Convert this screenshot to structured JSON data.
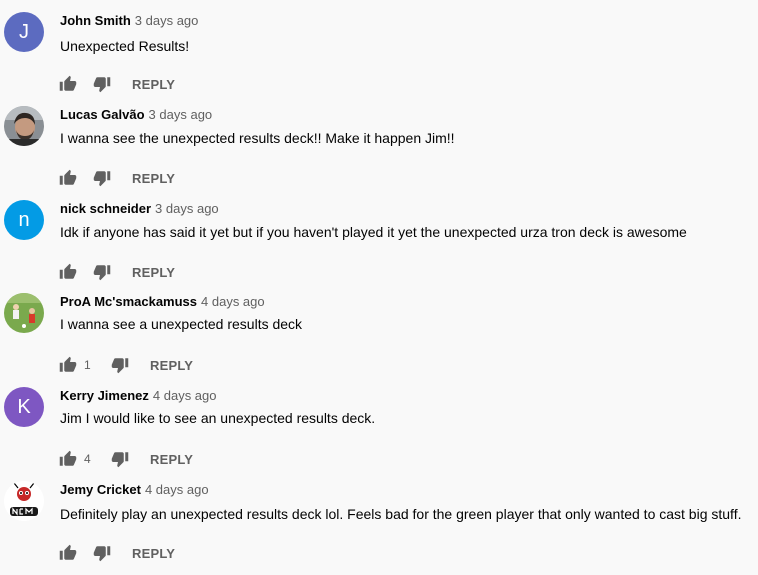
{
  "comments": [
    {
      "author": "John Smith",
      "time": "3 days ago",
      "text": "Unexpected Results!",
      "likes": "",
      "reply_label": "REPLY",
      "avatar": {
        "type": "letter",
        "letter": "J",
        "color": "#5c6bc0"
      }
    },
    {
      "author": "Lucas Galvão",
      "time": "3 days ago",
      "text": "I wanna see the unexpected results deck!! Make it happen Jim!!",
      "likes": "",
      "reply_label": "REPLY",
      "avatar": {
        "type": "photo-person"
      }
    },
    {
      "author": "nick schneider",
      "time": "3 days ago",
      "text": "Idk if anyone has said it yet but if you haven't played it yet the unexpected urza tron deck is awesome",
      "likes": "",
      "reply_label": "REPLY",
      "avatar": {
        "type": "letter",
        "letter": "n",
        "color": "#039be5"
      }
    },
    {
      "author": "ProA Mc'smackamuss",
      "time": "4 days ago",
      "text": "I wanna see a unexpected results deck",
      "likes": "1",
      "reply_label": "REPLY",
      "avatar": {
        "type": "photo-field"
      }
    },
    {
      "author": "Kerry Jimenez",
      "time": "4 days ago",
      "text": "Jim I would like to see an unexpected results deck.",
      "likes": "4",
      "reply_label": "REPLY",
      "avatar": {
        "type": "letter",
        "letter": "K",
        "color": "#7e57c2"
      }
    },
    {
      "author": "Jemy Cricket",
      "time": "4 days ago",
      "text": "Definitely play an unexpected results deck lol. Feels bad for the green player that only wanted to cast big stuff.",
      "likes": "",
      "reply_label": "REPLY",
      "avatar": {
        "type": "logo-cricket",
        "logo_text": "ncm"
      }
    }
  ],
  "colors": {
    "background": "#f9f9f9",
    "text_primary": "#030303",
    "text_secondary": "#606060",
    "icon": "#606060"
  },
  "icons": {
    "like": "thumb-up-icon",
    "dislike": "thumb-down-icon"
  }
}
